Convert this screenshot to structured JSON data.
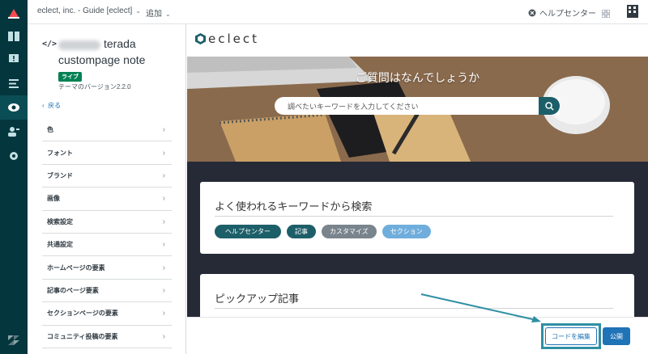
{
  "topbar": {
    "account": "eclect, inc. - Guide [eclect]",
    "add": "追加",
    "help_center": "ヘルプセンター"
  },
  "panel": {
    "title_line1": "terada",
    "title_line2": "custompage note",
    "badge": "ライブ",
    "version": "テーマのバージョン2.2.0",
    "back": "戻る",
    "menu": [
      "色",
      "フォント",
      "ブランド",
      "画像",
      "検索設定",
      "共通設定",
      "ホームページの要素",
      "記事のページ要素",
      "セクションページの要素",
      "コミュニティ投稿の要素"
    ]
  },
  "preview": {
    "logo": "eclect",
    "hero_title": "ご質問はなんでしょうか",
    "search_placeholder": "調べたいキーワードを入力してください",
    "keywords_title": "よく使われるキーワードから検索",
    "chips": [
      "ヘルプセンター",
      "記事",
      "カスタマイズ",
      "セクション"
    ],
    "pickup_title": "ピックアップ記事"
  },
  "footer": {
    "edit_code": "コードを編集",
    "publish": "公開"
  },
  "colors": {
    "rail": "#03363d",
    "accent": "#1d5f69",
    "primary_button": "#1f73b7",
    "annotation": "#2e8fa3"
  }
}
